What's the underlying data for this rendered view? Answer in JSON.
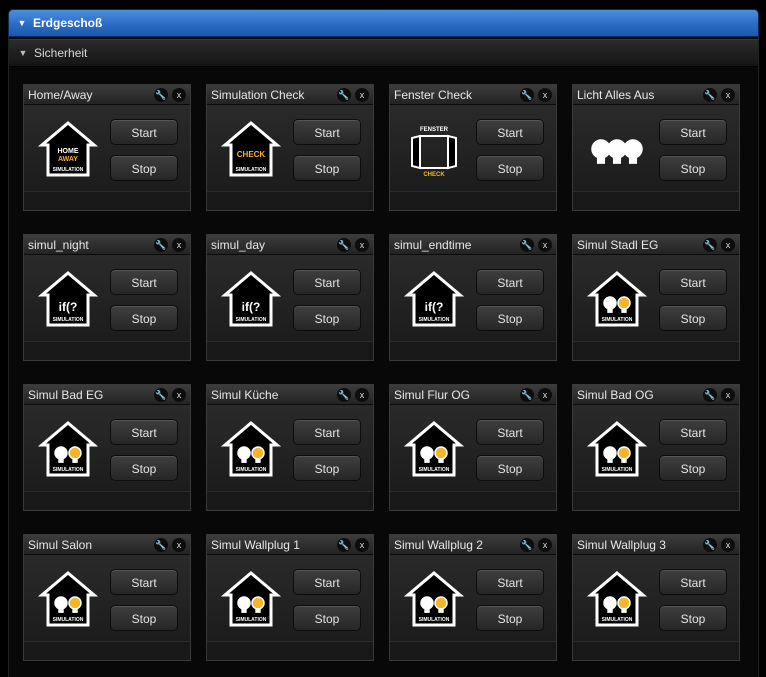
{
  "floor": {
    "title": "Erdgeschoß"
  },
  "section": {
    "title": "Sicherheit"
  },
  "card_buttons": {
    "start": "Start",
    "stop": "Stop",
    "tool_glyph": "🔧",
    "close_glyph": "x"
  },
  "icon_text": {
    "home": "HOME",
    "away": "AWAY",
    "simulation": "SIMULATION",
    "check": "CHECK",
    "fenster": "FENSTER",
    "if": "if(?"
  },
  "colors": {
    "accent_blue": "#2a6cc4",
    "icon_yellow": "#f5b52b",
    "icon_white": "#ffffff"
  },
  "cards": [
    {
      "title": "Home/Away",
      "icon": "home-away-icon"
    },
    {
      "title": "Simulation Check",
      "icon": "simulation-check-icon"
    },
    {
      "title": "Fenster Check",
      "icon": "window-check-icon"
    },
    {
      "title": "Licht Alles Aus",
      "icon": "bulbs-icon"
    },
    {
      "title": "simul_night",
      "icon": "if-simulation-icon"
    },
    {
      "title": "simul_day",
      "icon": "if-simulation-icon"
    },
    {
      "title": "simul_endtime",
      "icon": "if-simulation-icon"
    },
    {
      "title": "Simul Stadl EG",
      "icon": "light-simulation-icon"
    },
    {
      "title": "Simul Bad EG",
      "icon": "light-simulation-icon"
    },
    {
      "title": "Simul Küche",
      "icon": "light-simulation-icon"
    },
    {
      "title": "Simul Flur OG",
      "icon": "light-simulation-icon"
    },
    {
      "title": "Simul Bad OG",
      "icon": "light-simulation-icon"
    },
    {
      "title": "Simul Salon",
      "icon": "light-simulation-icon"
    },
    {
      "title": "Simul Wallplug 1",
      "icon": "light-simulation-icon"
    },
    {
      "title": "Simul Wallplug 2",
      "icon": "light-simulation-icon"
    },
    {
      "title": "Simul Wallplug 3",
      "icon": "light-simulation-icon"
    }
  ]
}
